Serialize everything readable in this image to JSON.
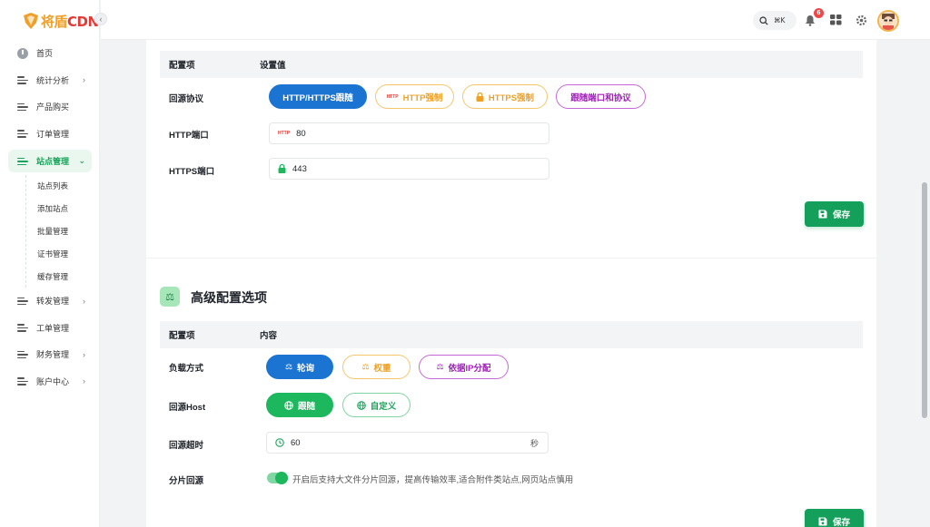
{
  "brand": {
    "logo_cn": "将盾",
    "logo_en": "CDN"
  },
  "sidebar": {
    "items": [
      {
        "label": "首页"
      },
      {
        "label": "统计分析",
        "arrow": "›"
      },
      {
        "label": "产品购买"
      },
      {
        "label": "订单管理"
      },
      {
        "label": "站点管理",
        "arrow": "⌄",
        "active": true
      },
      {
        "label": "转发管理",
        "arrow": "›"
      },
      {
        "label": "工单管理"
      },
      {
        "label": "财务管理",
        "arrow": "›"
      },
      {
        "label": "账户中心",
        "arrow": "›"
      }
    ],
    "subitems": [
      "站点列表",
      "添加站点",
      "批量管理",
      "证书管理",
      "缓存管理"
    ]
  },
  "topbar": {
    "search_shortcut": "⌘K",
    "notification_count": "6"
  },
  "origin_section": {
    "header": {
      "col1": "配置项",
      "col2": "设置值"
    },
    "protocol": {
      "label": "回源协议",
      "options": [
        "HTTP/HTTPS跟随",
        "HTTP强制",
        "HTTPS强制",
        "跟随端口和协议"
      ],
      "selected": "HTTP/HTTPS跟随"
    },
    "http_port": {
      "label": "HTTP端口",
      "value": "80"
    },
    "https_port": {
      "label": "HTTPS端口",
      "value": "443"
    },
    "save_label": "保存"
  },
  "advanced_section": {
    "title": "高级配置选项",
    "header": {
      "col1": "配置项",
      "col2": "内容"
    },
    "load_balance": {
      "label": "负载方式",
      "options": [
        "轮询",
        "权重",
        "依据IP分配"
      ],
      "selected": "轮询"
    },
    "origin_host": {
      "label": "回源Host",
      "options": [
        "跟随",
        "自定义"
      ],
      "selected": "跟随"
    },
    "timeout": {
      "label": "回源超时",
      "value": "60",
      "unit": "秒"
    },
    "range_origin": {
      "label": "分片回源",
      "enabled": true,
      "description": "开启后支持大文件分片回源，提高传输效率,适合附件类站点,网页站点慎用"
    },
    "save_label": "保存"
  },
  "colors": {
    "primary_green": "#14a05a",
    "primary_blue": "#1b74d1",
    "orange": "#f0a020",
    "purple": "#a020b8"
  }
}
